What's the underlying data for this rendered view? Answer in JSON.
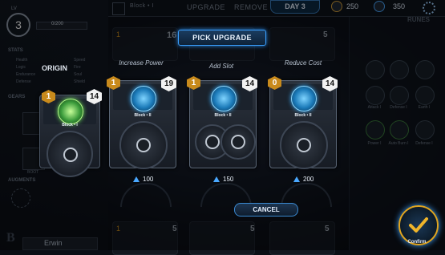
{
  "topbar": {
    "item_label": "Block • I",
    "upgrade_label": "UPGRADE",
    "remove_label": "REMOVE",
    "day_label": "DAY 3",
    "resource1": "250",
    "resource2": "350",
    "runes_label": "RUNES"
  },
  "hero": {
    "lv_label": "LV",
    "level": "3",
    "xp": "0/200",
    "stats_label": "STATS",
    "stats": [
      "Health",
      "Logic",
      "Endurance",
      "Defense",
      "Speed",
      "Fire",
      "Soul",
      "Shield"
    ],
    "gears_label": "GEARS",
    "boot_label": "BOOT",
    "augments_label": "AUGMENTS",
    "name": "Erwin",
    "skull_label": "SKULL"
  },
  "dialog": {
    "title": "PICK UPGRADE",
    "origin_label": "ORIGIN",
    "cancel_label": "CANCEL",
    "confirm_label": "Confirm",
    "origin_card": {
      "cost": "1",
      "power": "14",
      "name": "Block • I"
    },
    "options": [
      {
        "heading": "Increase Power",
        "cost": "1",
        "power": "19",
        "name": "Block • II",
        "price": "100"
      },
      {
        "heading": "Add Slot",
        "cost": "1",
        "power": "14",
        "name": "Block • II",
        "price": "150"
      },
      {
        "heading": "Reduce Cost",
        "cost": "0",
        "power": "14",
        "name": "Block • II",
        "price": "200"
      }
    ]
  },
  "background_cards": {
    "top_costs": [
      "1",
      "16",
      "5",
      "5"
    ],
    "bottom_costs": [
      "1",
      "5",
      "5",
      "5"
    ]
  },
  "runes": {
    "labels": [
      "Attack I",
      "Defense I",
      "Earth I",
      "Power I",
      "Auto Burn I",
      "Defense I"
    ]
  }
}
